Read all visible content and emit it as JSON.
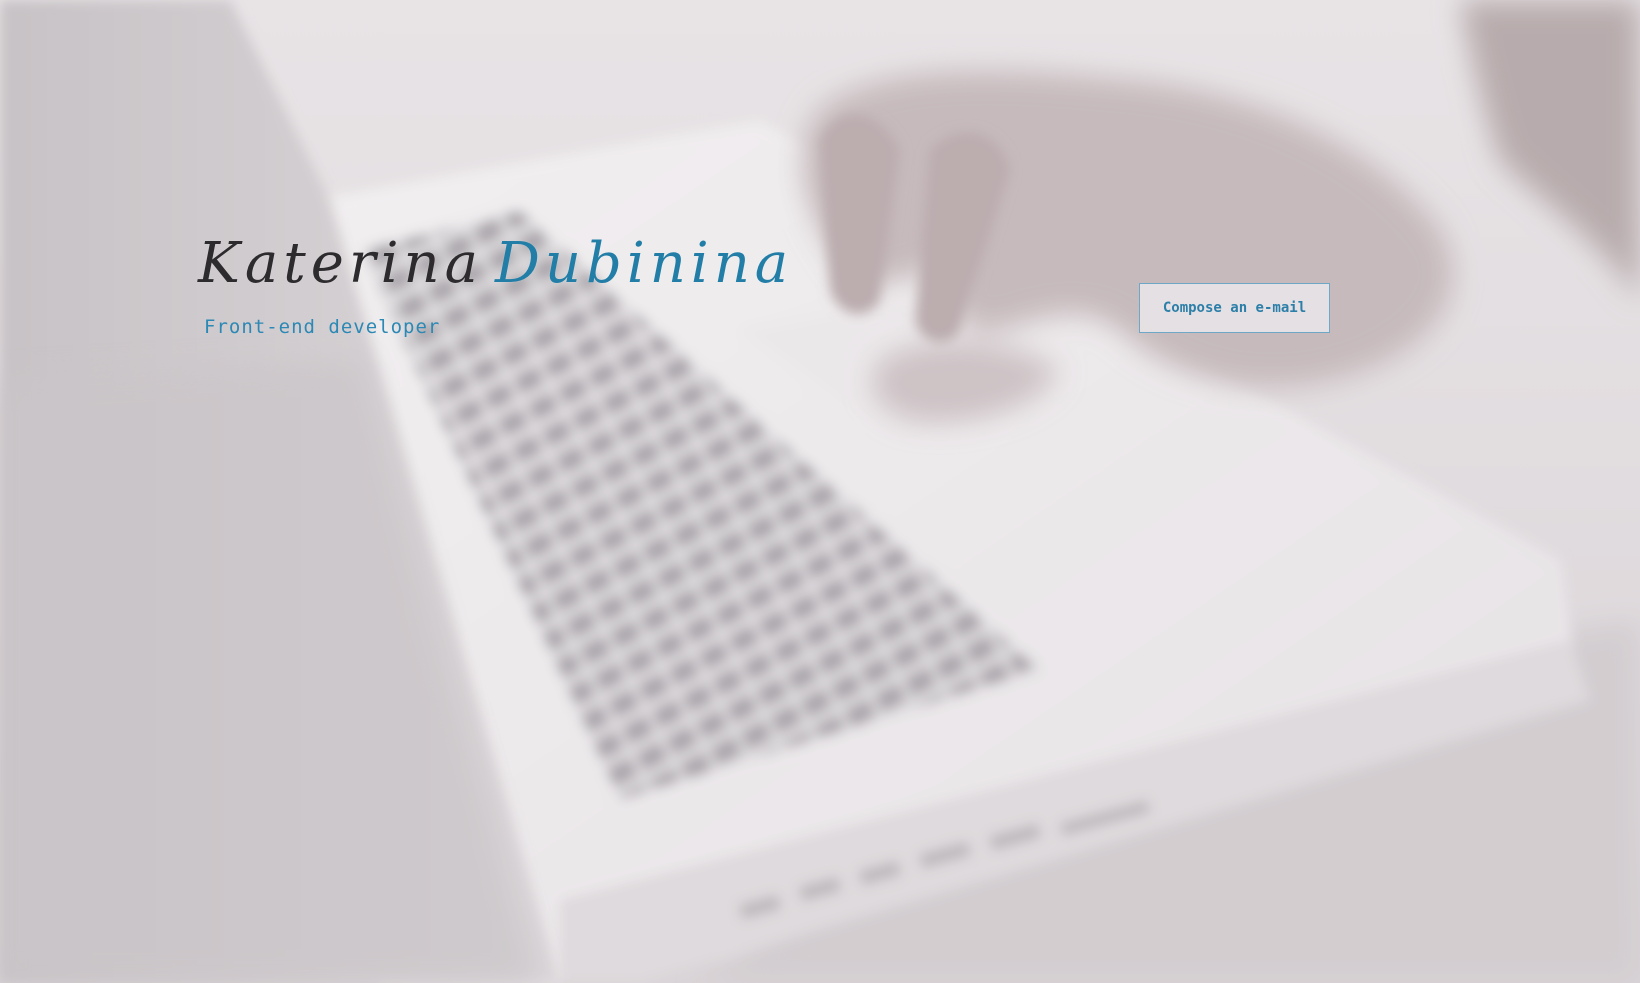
{
  "hero": {
    "background": {
      "description_icon": "laptop-keyboard-hands-photo",
      "overlay_color": "#e4e0e3"
    }
  },
  "profile": {
    "first_name": "Katerina",
    "last_name": "Dubinina",
    "title": "Front-end developer"
  },
  "actions": {
    "compose_label": "Compose an e-mail"
  },
  "colors": {
    "accent": "#227ea6",
    "name_dark": "#2d2b2d",
    "button_border": "#6ea8c6"
  }
}
